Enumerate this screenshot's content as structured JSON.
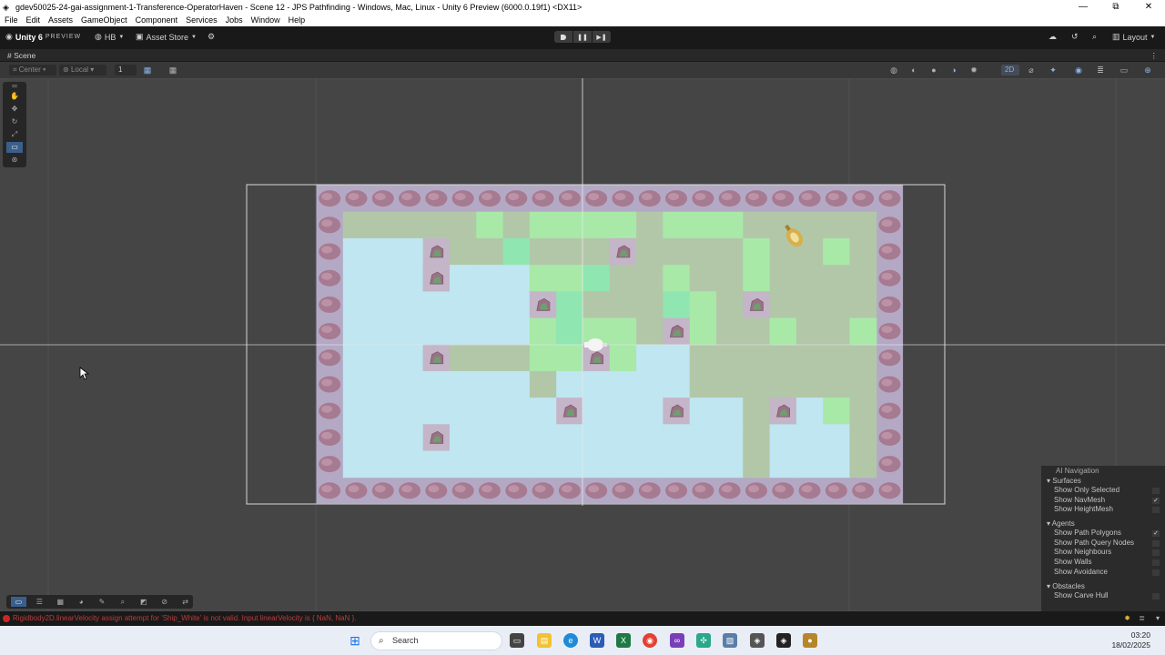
{
  "window": {
    "title": "gdev50025-24-gai-assignment-1-Transference-OperatorHaven - Scene 12 - JPS Pathfinding - Windows, Mac, Linux - Unity 6 Preview (6000.0.19f1) <DX11>",
    "controls": [
      "—",
      "⧉",
      "✕"
    ]
  },
  "menu": [
    "File",
    "Edit",
    "Assets",
    "GameObject",
    "Component",
    "Services",
    "Jobs",
    "Window",
    "Help"
  ],
  "toolbar": {
    "unity_label": "Unity 6",
    "preview_label": "PREVIEW",
    "account": "HB",
    "asset_store": "Asset Store",
    "layout": "Layout"
  },
  "scene_tab": {
    "label": "Scene"
  },
  "scene_toolbar": {
    "pivot": "Center",
    "space": "Local",
    "snap_value": "1",
    "mode_2d": "2D"
  },
  "grid": {
    "cols": 20,
    "rows": 10,
    "tiles": [
      "GGGGGLGLLLLGLLLGGGGG",
      "WWWLGGMGGGGGGGGLGGLG",
      "WWWGWWWLLMGGLGGLGGGG",
      "WWWWWWWLMGGGMLGGGGGG",
      "WWWWWWWLMLLGGLGGLGGL",
      "WWWGGGGLLGLWWGGGGGGG",
      "WWWWWWWGWWWWWGGGGGGG",
      "WWWWWWWWWWWWWWWGGWLG",
      "WWWWWWWWWWWWWWWGWWWG",
      "WWWWWWWWWWWWWWWGWWWG"
    ],
    "rocks": [
      [
        4,
        2
      ],
      [
        11,
        2
      ],
      [
        4,
        3
      ],
      [
        8,
        4
      ],
      [
        16,
        4
      ],
      [
        13,
        5
      ],
      [
        4,
        6
      ],
      [
        10,
        6
      ],
      [
        9,
        8
      ],
      [
        13,
        8
      ],
      [
        17,
        8
      ],
      [
        4,
        9
      ]
    ],
    "boulder_border": true,
    "colors": {
      "water": "#bfe6f1",
      "grass": "#b2c7a8",
      "light": "#a8e9a8",
      "mint": "#8fe6b0",
      "rock_cell": "#c4b5c8",
      "border": "#b4a9c5",
      "boulder": "#a67a90"
    }
  },
  "nav_panel": {
    "title": "AI Navigation",
    "sections": [
      {
        "name": "Surfaces",
        "items": [
          {
            "label": "Show Only Selected",
            "checked": false
          },
          {
            "label": "Show NavMesh",
            "checked": true
          },
          {
            "label": "Show HeightMesh",
            "checked": false
          }
        ]
      },
      {
        "name": "Agents",
        "items": [
          {
            "label": "Show Path Polygons",
            "checked": true
          },
          {
            "label": "Show Path Query Nodes",
            "checked": false
          },
          {
            "label": "Show Neighbours",
            "checked": false
          },
          {
            "label": "Show Walls",
            "checked": false
          },
          {
            "label": "Show Avoidance",
            "checked": false
          }
        ]
      },
      {
        "name": "Obstacles",
        "items": [
          {
            "label": "Show Carve Hull",
            "checked": false
          }
        ]
      }
    ]
  },
  "status": {
    "message": "Rigidbody2D.linearVelocity assign attempt for 'Ship_White' is not valid. Input linearVelocity is { NaN, NaN }."
  },
  "taskbar": {
    "search_placeholder": "Search",
    "time": "03:20",
    "date": "18/02/2025"
  }
}
